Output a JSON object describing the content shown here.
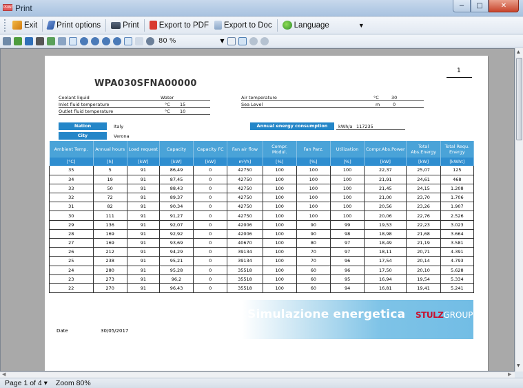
{
  "window": {
    "title": "Print",
    "app_icon_text": "PRINT"
  },
  "toolbar": {
    "exit_label": "Exit",
    "print_options_label": "Print options",
    "print_label": "Print",
    "export_pdf_label": "Export to PDF",
    "export_doc_label": "Export to Doc",
    "language_label": "Language"
  },
  "toolbar2": {
    "zoom_value": "80 %"
  },
  "report": {
    "page_number": "1",
    "model_code": "WPA030SFNA00000",
    "params_left": [
      {
        "label": "Coolant liquid",
        "unit": "",
        "value": "Water"
      },
      {
        "label": "Inlet fluid temperature",
        "unit": "°C",
        "value": "15"
      },
      {
        "label": "Outlet fluid temperature",
        "unit": "°C",
        "value": "10"
      }
    ],
    "params_right": [
      {
        "label": "Air temperature",
        "unit": "°C",
        "value": "30"
      },
      {
        "label": "Sea Level",
        "unit": "m",
        "value": "0"
      }
    ],
    "nation_label": "Nation",
    "nation_value": "Italy",
    "city_label": "City",
    "city_value": "Verona",
    "annual_label": "Annual energy consumption",
    "annual_unit": "kWh/a",
    "annual_value": "117235",
    "columns": [
      "Ambient Temp.",
      "Annual hours",
      "Load request",
      "Capacity",
      "Capacity FC",
      "Fan air flow",
      "Compr. Modul.",
      "Fan Parz.",
      "Utilization",
      "Compr.Abs.Power",
      "Total Abs.Energy",
      "Total Requ. Energy"
    ],
    "units": [
      "[°C]",
      "[h]",
      "[kW]",
      "[kW]",
      "[kW]",
      "m³/h]",
      "[%]",
      "[%]",
      "[%]",
      "[kW]",
      "[kW]",
      "[kWht]"
    ],
    "rows": [
      [
        "35",
        "5",
        "91",
        "86,49",
        "0",
        "42750",
        "100",
        "100",
        "100",
        "22,37",
        "25,07",
        "125"
      ],
      [
        "34",
        "19",
        "91",
        "87,45",
        "0",
        "42750",
        "100",
        "100",
        "100",
        "21,91",
        "24,61",
        "468"
      ],
      [
        "33",
        "50",
        "91",
        "88,43",
        "0",
        "42750",
        "100",
        "100",
        "100",
        "21,45",
        "24,15",
        "1.208"
      ],
      [
        "32",
        "72",
        "91",
        "89,37",
        "0",
        "42750",
        "100",
        "100",
        "100",
        "21,00",
        "23,70",
        "1.706"
      ],
      [
        "31",
        "82",
        "91",
        "90,34",
        "0",
        "42750",
        "100",
        "100",
        "100",
        "20,56",
        "23,26",
        "1.907"
      ],
      [
        "30",
        "111",
        "91",
        "91,27",
        "0",
        "42750",
        "100",
        "100",
        "100",
        "20,06",
        "22,76",
        "2.526"
      ],
      [
        "29",
        "136",
        "91",
        "92,07",
        "0",
        "42006",
        "100",
        "90",
        "99",
        "19,53",
        "22,23",
        "3.023"
      ],
      [
        "28",
        "169",
        "91",
        "92,92",
        "0",
        "42006",
        "100",
        "90",
        "98",
        "18,98",
        "21,68",
        "3.664"
      ],
      [
        "27",
        "169",
        "91",
        "93,69",
        "0",
        "40670",
        "100",
        "80",
        "97",
        "18,49",
        "21,19",
        "3.581"
      ],
      [
        "26",
        "212",
        "91",
        "94,29",
        "0",
        "39134",
        "100",
        "70",
        "97",
        "18,11",
        "20,71",
        "4.391"
      ],
      [
        "25",
        "238",
        "91",
        "95,21",
        "0",
        "39134",
        "100",
        "70",
        "96",
        "17,54",
        "20,14",
        "4.793"
      ],
      [
        "24",
        "280",
        "91",
        "95,28",
        "0",
        "35518",
        "100",
        "60",
        "96",
        "17,50",
        "20,10",
        "5.628"
      ],
      [
        "23",
        "273",
        "91",
        "96,2",
        "0",
        "35518",
        "100",
        "60",
        "95",
        "16,94",
        "19,54",
        "5.334"
      ],
      [
        "22",
        "270",
        "91",
        "96,43",
        "0",
        "35518",
        "100",
        "60",
        "94",
        "16,81",
        "19,41",
        "5.241"
      ]
    ],
    "banner_title": "Simulazione energetica",
    "logo_main": "STULZ",
    "logo_sub": "GROUP",
    "date_label": "Date",
    "date_value": "30/05/2017"
  },
  "status": {
    "page_label": "Page 1 of 4 ▾",
    "zoom_label": "Zoom 80%"
  },
  "colors": {
    "header_blue": "#4aa3d8",
    "badge_blue": "#2486c8",
    "logo_red": "#c8102e"
  }
}
